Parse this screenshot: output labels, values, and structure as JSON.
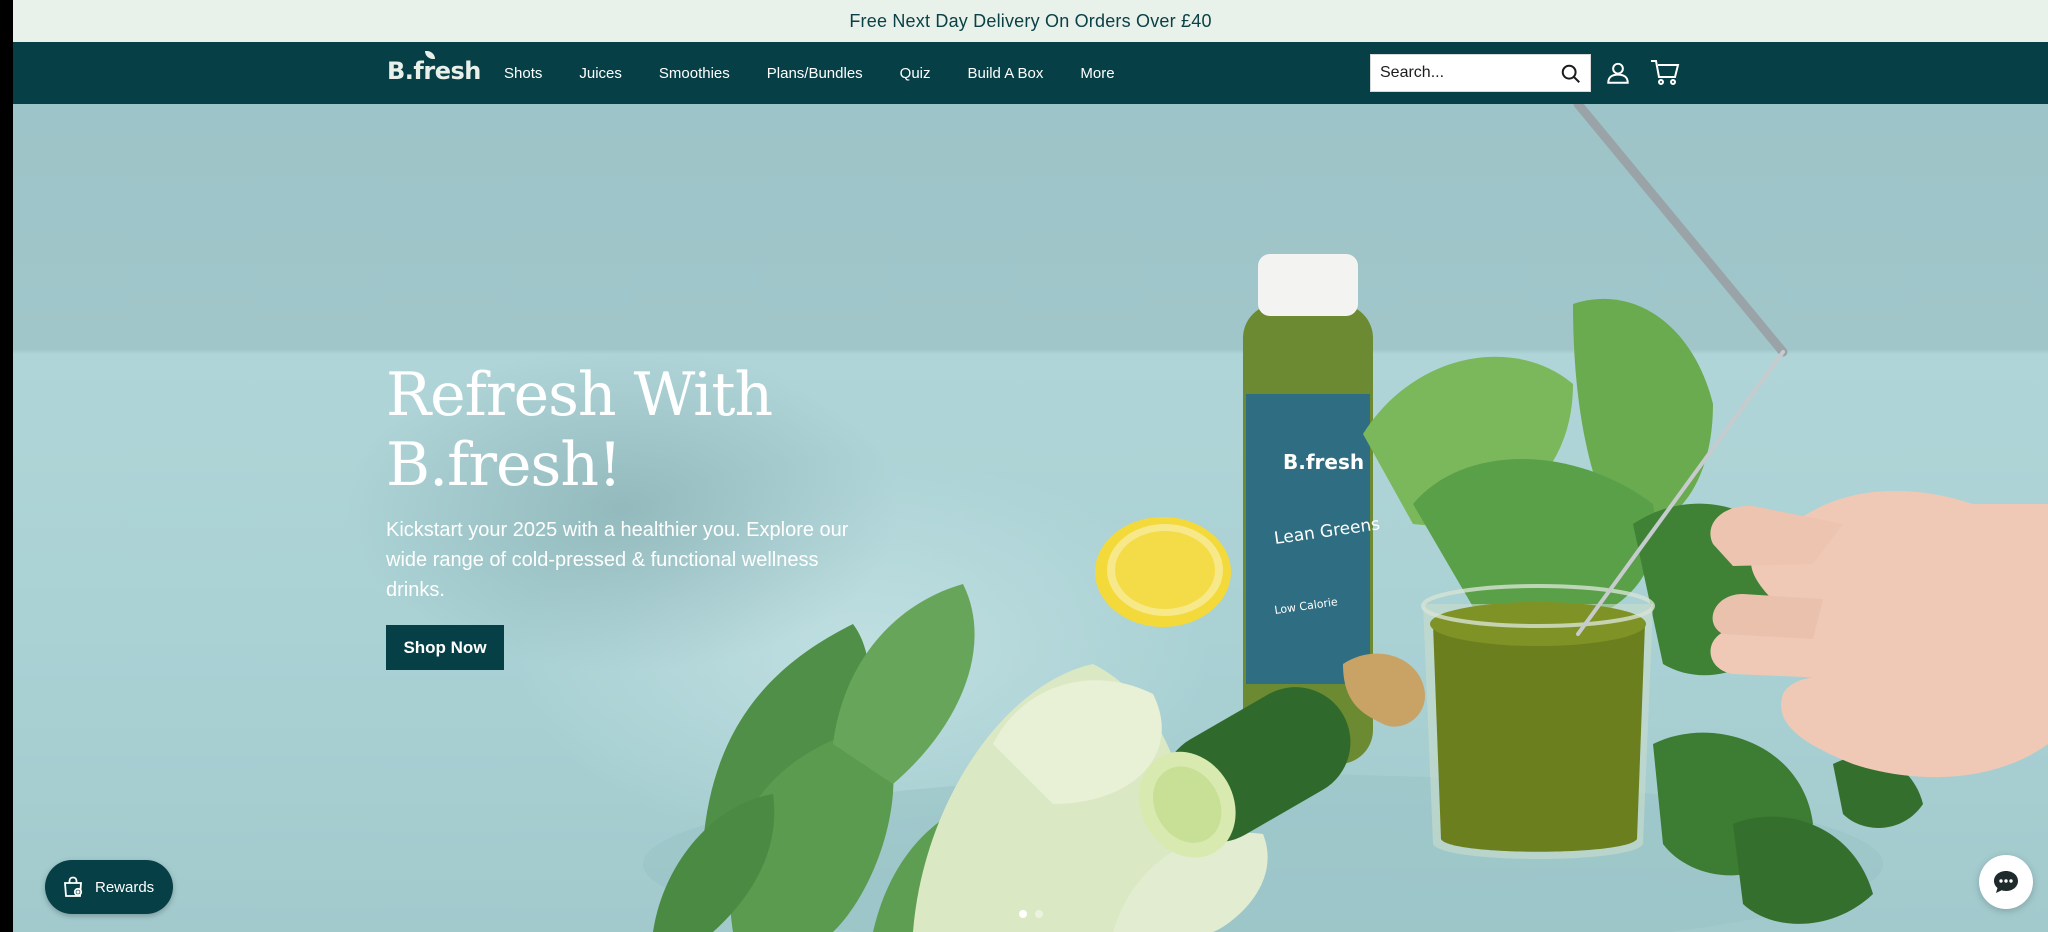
{
  "announcement": {
    "text": "Free Next Day Delivery On Orders Over £40"
  },
  "header": {
    "logo": "B.fresh",
    "nav": [
      {
        "label": "Shots"
      },
      {
        "label": "Juices"
      },
      {
        "label": "Smoothies"
      },
      {
        "label": "Plans/Bundles"
      },
      {
        "label": "Quiz"
      },
      {
        "label": "Build A Box"
      },
      {
        "label": "More"
      }
    ],
    "search": {
      "placeholder": "Search..."
    },
    "icons": {
      "search": "search-icon",
      "account": "account-icon",
      "cart": "cart-icon"
    }
  },
  "hero": {
    "title_line1": "Refresh With",
    "title_line2": "B.fresh!",
    "subtitle": "Kickstart your 2025 with a healthier you. Explore our wide range of cold-pressed & functional wellness drinks.",
    "cta": "Shop Now",
    "bottle": {
      "brand": "B.fresh",
      "name": "Lean Greens",
      "tag": "Low Calorie"
    },
    "slides": {
      "total": 2,
      "active": 1
    }
  },
  "widgets": {
    "rewards_label": "Rewards",
    "chat_icon": "chat-icon"
  },
  "colors": {
    "brand_dark": "#064046",
    "announce_bg": "#e8f2ea",
    "hero_bg": "#a9cdd1"
  }
}
